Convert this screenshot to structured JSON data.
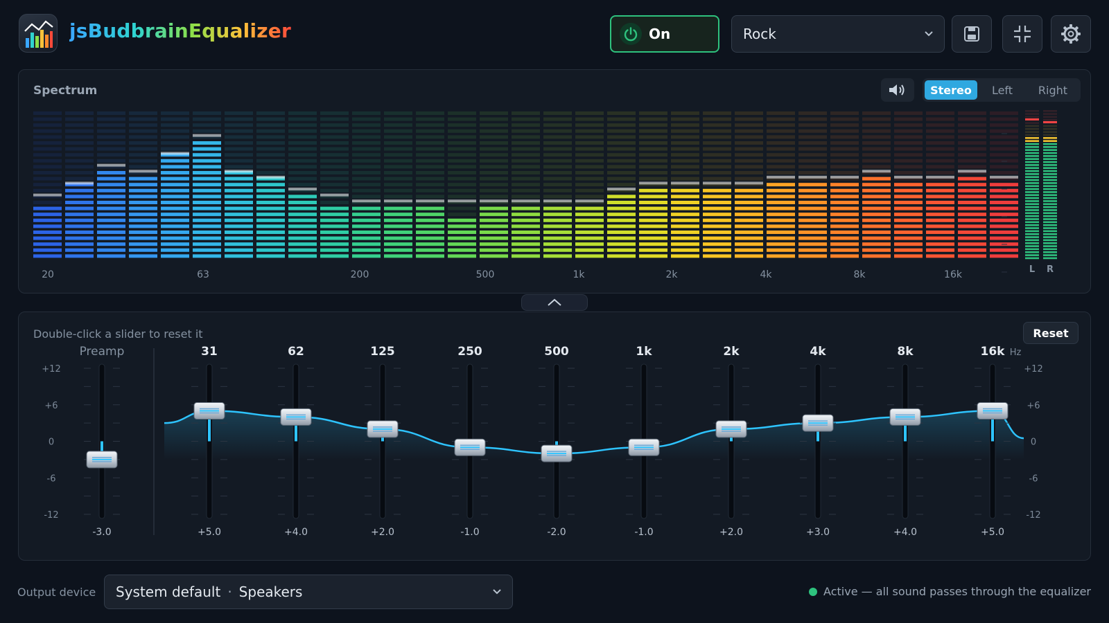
{
  "header": {
    "title": "jsBudbrainEqualizer",
    "power_label": "On",
    "preset_value": "Rock",
    "icons": [
      "save-icon",
      "compact-view-icon",
      "settings-gear-icon"
    ]
  },
  "spectrum": {
    "title": "Spectrum",
    "channels": [
      "Stereo",
      "Left",
      "Right"
    ],
    "active_channel": "Stereo",
    "freq_labels": [
      "20",
      "63",
      "200",
      "500",
      "1k",
      "2k",
      "4k",
      "8k",
      "16k"
    ],
    "meter_labels": [
      "L",
      "R"
    ],
    "band_levels": [
      9,
      13,
      15,
      14,
      18,
      20,
      15,
      14,
      11,
      9,
      9,
      9,
      9,
      7,
      9,
      9,
      9,
      9,
      11,
      12,
      12,
      12,
      12,
      13,
      13,
      13,
      14,
      13,
      13,
      14,
      13
    ],
    "band_peaks": [
      10,
      12,
      15,
      14,
      17,
      20,
      14,
      13,
      11,
      10,
      9,
      9,
      9,
      9,
      9,
      9,
      9,
      9,
      11,
      12,
      12,
      12,
      12,
      13,
      13,
      13,
      14,
      13,
      13,
      14,
      13
    ],
    "band_colors": [
      "#2c63e6",
      "#2f74ea",
      "#3287ee",
      "#3597f0",
      "#35a8ef",
      "#34b6e9",
      "#31c0dc",
      "#2ec7cb",
      "#2dcab8",
      "#2fcda4",
      "#35d08f",
      "#40d27a",
      "#4fd567",
      "#63d856",
      "#79da4a",
      "#8fdc40",
      "#a6de38",
      "#bcdf31",
      "#d0df2b",
      "#e2db27",
      "#f0d225",
      "#f8c524",
      "#fcb524",
      "#fea425",
      "#ff9327",
      "#ff8229",
      "#ff722c",
      "#fd632f",
      "#f95533",
      "#f44837",
      "#ee3d3c"
    ],
    "meter_left": 0.82,
    "meter_right": 0.82
  },
  "eq": {
    "hint": "Double-click a slider to reset it",
    "reset_label": "Reset",
    "scale_labels": [
      "+12",
      "+6",
      "0",
      "-6",
      "-12"
    ],
    "unit": "Hz",
    "preamp": {
      "label": "Preamp",
      "gain": -3.0,
      "value_label": "-3.0"
    },
    "bands": [
      {
        "freq": "31",
        "gain": 5.0,
        "value_label": "+5.0"
      },
      {
        "freq": "62",
        "gain": 4.0,
        "value_label": "+4.0"
      },
      {
        "freq": "125",
        "gain": 2.0,
        "value_label": "+2.0"
      },
      {
        "freq": "250",
        "gain": -1.0,
        "value_label": "-1.0"
      },
      {
        "freq": "500",
        "gain": -2.0,
        "value_label": "-2.0"
      },
      {
        "freq": "1k",
        "gain": -1.0,
        "value_label": "-1.0"
      },
      {
        "freq": "2k",
        "gain": 2.0,
        "value_label": "+2.0"
      },
      {
        "freq": "4k",
        "gain": 3.0,
        "value_label": "+3.0"
      },
      {
        "freq": "8k",
        "gain": 4.0,
        "value_label": "+4.0"
      },
      {
        "freq": "16k",
        "gain": 5.0,
        "value_label": "+5.0"
      }
    ],
    "accent_color": "#2ec4ff"
  },
  "footer": {
    "output_label": "Output device",
    "device_value": "System default",
    "device_sub": "Speakers",
    "status_text": "Active — all sound passes through the equalizer",
    "status_color": "#2ec27e"
  }
}
